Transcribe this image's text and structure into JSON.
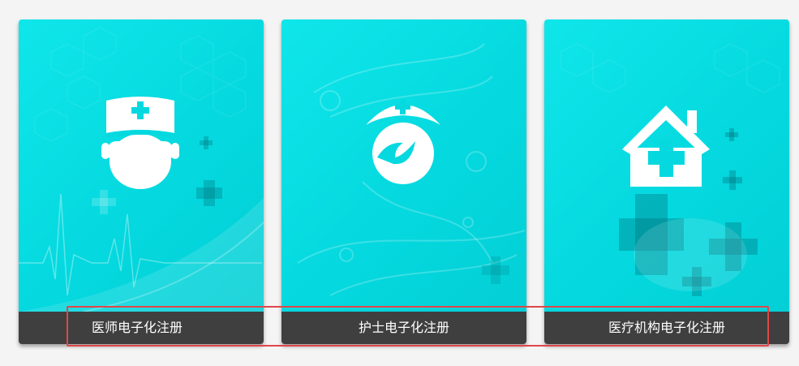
{
  "cards": [
    {
      "label": "医师电子化注册",
      "icon": "doctor-icon"
    },
    {
      "label": "护士电子化注册",
      "icon": "nurse-icon"
    },
    {
      "label": "医疗机构电子化注册",
      "icon": "hospital-house-icon"
    }
  ],
  "colors": {
    "card_bg": "#05d9df",
    "footer_bg": "#3f3f3f",
    "footer_text": "#ffffff",
    "highlight": "#e0474a"
  }
}
